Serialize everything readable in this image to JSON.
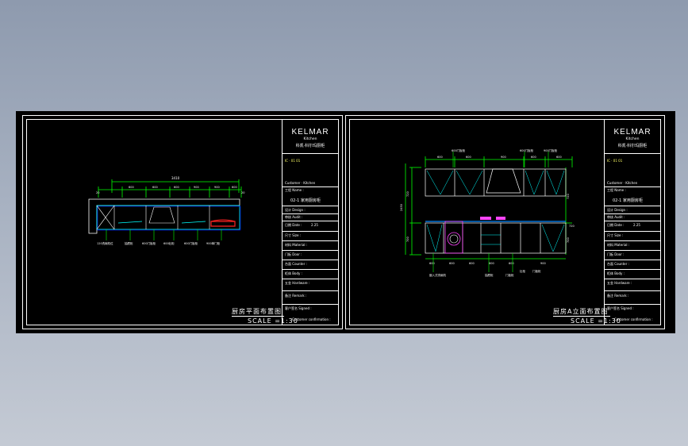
{
  "brand": {
    "name": "KELMAR",
    "sub": "Kitchen",
    "cn": "科凯·科尔玛厨柜"
  },
  "left_sheet": {
    "title": "厨房平面布置图",
    "scale": "SCALE =1:30",
    "dims_top": [
      "3410"
    ],
    "dims_mid": [
      "20",
      "600",
      "600",
      "600",
      "900",
      "900",
      "600",
      "20"
    ],
    "labels": [
      "120洗碗机位",
      "抽屉柜",
      "600门板柜",
      "600灶柜",
      "600门板柜",
      "900单门柜"
    ]
  },
  "right_sheet": {
    "title": "厨房A立面布置图",
    "scale": "SCALE =1:30",
    "dims_top": [
      "600",
      "600",
      "900",
      "600",
      "600"
    ],
    "dims_bottom": [
      "600",
      "600",
      "600",
      "600",
      "600",
      "900"
    ],
    "dims_left": [
      "2450",
      "720",
      "700"
    ],
    "dims_right": [
      "720",
      "720",
      "700"
    ],
    "labels_top": [
      "600门板柜",
      "600门板柜",
      "900门板柜"
    ],
    "labels_bottom": [
      "嵌入式洗碗机",
      "抽屉柜",
      "门板柜",
      "灶柜",
      "门板柜"
    ]
  },
  "title_block": {
    "rows": [
      "IC · 01 01",
      "Customer · Kitchen",
      "工程 Name :",
      "02-1 家用厨房柜",
      "设计 Design :",
      "审核 Audit :",
      "日期 Date :",
      "尺寸 Size :",
      "材料 Material :",
      "门板 Door :",
      "台面 Counter :",
      "柜体 Body :",
      "五金 Hardware :",
      "备注 Remark :",
      "客户签名 Signed :",
      "Customer confirmation :"
    ],
    "date_val": "2.25"
  }
}
